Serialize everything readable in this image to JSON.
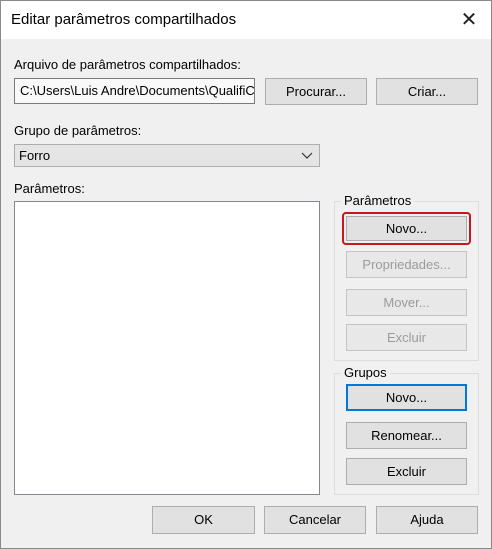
{
  "window": {
    "title": "Editar parâmetros compartilhados",
    "close_glyph": "✕"
  },
  "file": {
    "label": "Arquivo de parâmetros compartilhados:",
    "path": "C:\\Users\\Luis Andre\\Documents\\QualifiC",
    "browse_label": "Procurar...",
    "create_label": "Criar..."
  },
  "group_select": {
    "label": "Grupo de parâmetros:",
    "value": "Forro"
  },
  "parameters_list": {
    "label": "Parâmetros:",
    "items": []
  },
  "parameters_box": {
    "title": "Parâmetros",
    "new_label": "Novo...",
    "properties_label": "Propriedades...",
    "move_label": "Mover...",
    "delete_label": "Excluir"
  },
  "groups_box": {
    "title": "Grupos",
    "new_label": "Novo...",
    "rename_label": "Renomear...",
    "delete_label": "Excluir"
  },
  "footer": {
    "ok_label": "OK",
    "cancel_label": "Cancelar",
    "help_label": "Ajuda"
  },
  "colors": {
    "highlight": "#c9151e",
    "focus": "#0078d7"
  },
  "icons": {
    "close": "close-icon",
    "dropdown": "chevron-down-icon"
  }
}
